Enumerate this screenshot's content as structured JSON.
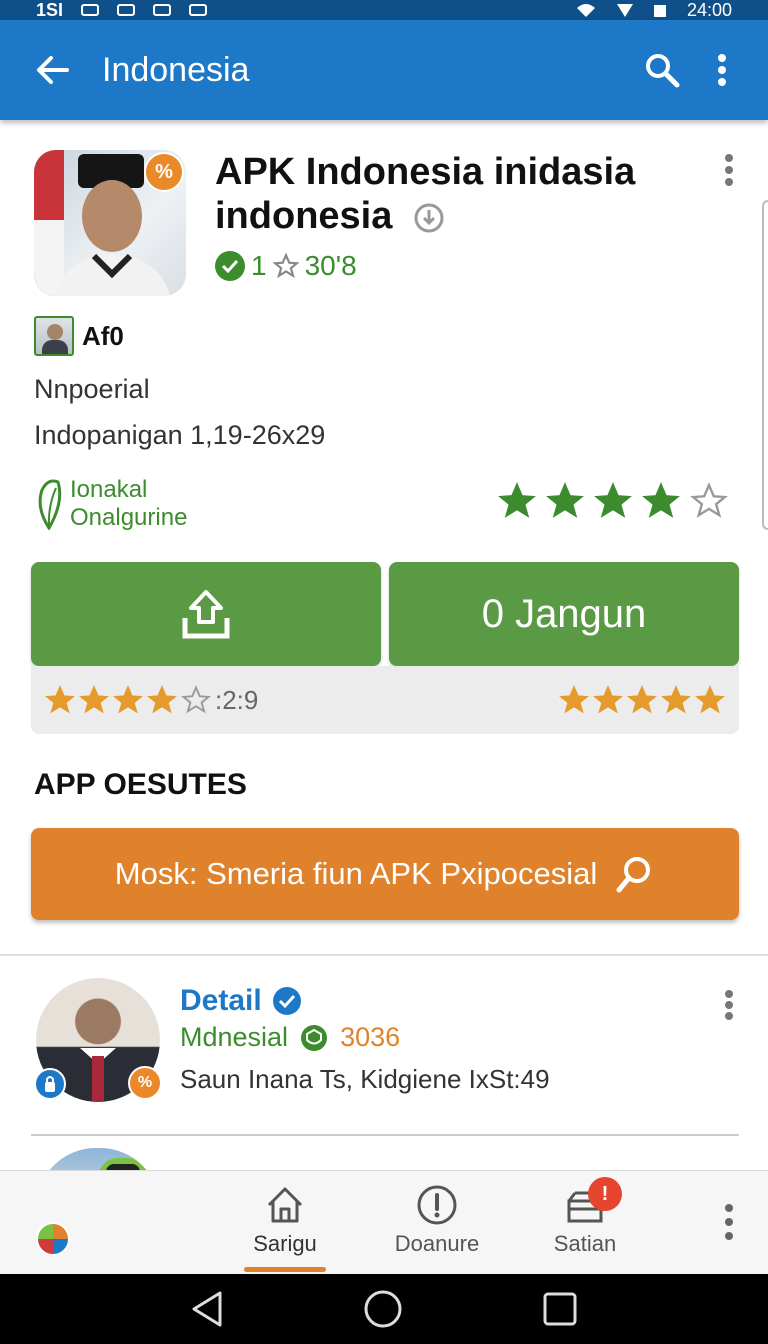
{
  "status_bar": {
    "left_text": "1SI",
    "time": "24:00"
  },
  "toolbar": {
    "title": "Indonesia",
    "back_icon": "arrow-left-icon",
    "search_icon": "search-icon",
    "menu_icon": "more-vert-icon"
  },
  "app": {
    "title": "APK Indonesia inidasia indonesia",
    "icon_badge": "%",
    "rating_prefix": "1",
    "rating_value": "30'8",
    "developer": "Af0",
    "category": "Nnpoerial",
    "version": "Indopanigan 1,19-26x29",
    "brand_line1": "Ionakal",
    "brand_line2": "Onalgurine",
    "stars_filled": 4,
    "stars_total": 5
  },
  "buttons": {
    "upload_icon": "upload-icon",
    "download_label": "0 Jangun"
  },
  "rating_bar": {
    "left_stars": 4,
    "left_value": ":2:9",
    "right_stars": 5
  },
  "section": {
    "title": "APP OESUTES"
  },
  "promo": {
    "label": "Mosk: Smeria fiun APK Pxipocesial"
  },
  "list_item": {
    "title": "Detail",
    "subtitle": "Mdnesial",
    "count": "3036",
    "description": "Saun Inana Ts, Kidgiene IxSt:49",
    "badge_text": "%"
  },
  "bottom_nav": {
    "items": [
      {
        "label": "Sarigu",
        "icon": "home-icon"
      },
      {
        "label": "Doanure",
        "icon": "info-icon"
      },
      {
        "label": "Satian",
        "icon": "inbox-icon"
      }
    ],
    "notification": "!"
  },
  "colors": {
    "primary": "#1e78c8",
    "green": "#5a9a45",
    "orange": "#e0822b",
    "star_gold": "#e59b2b"
  }
}
